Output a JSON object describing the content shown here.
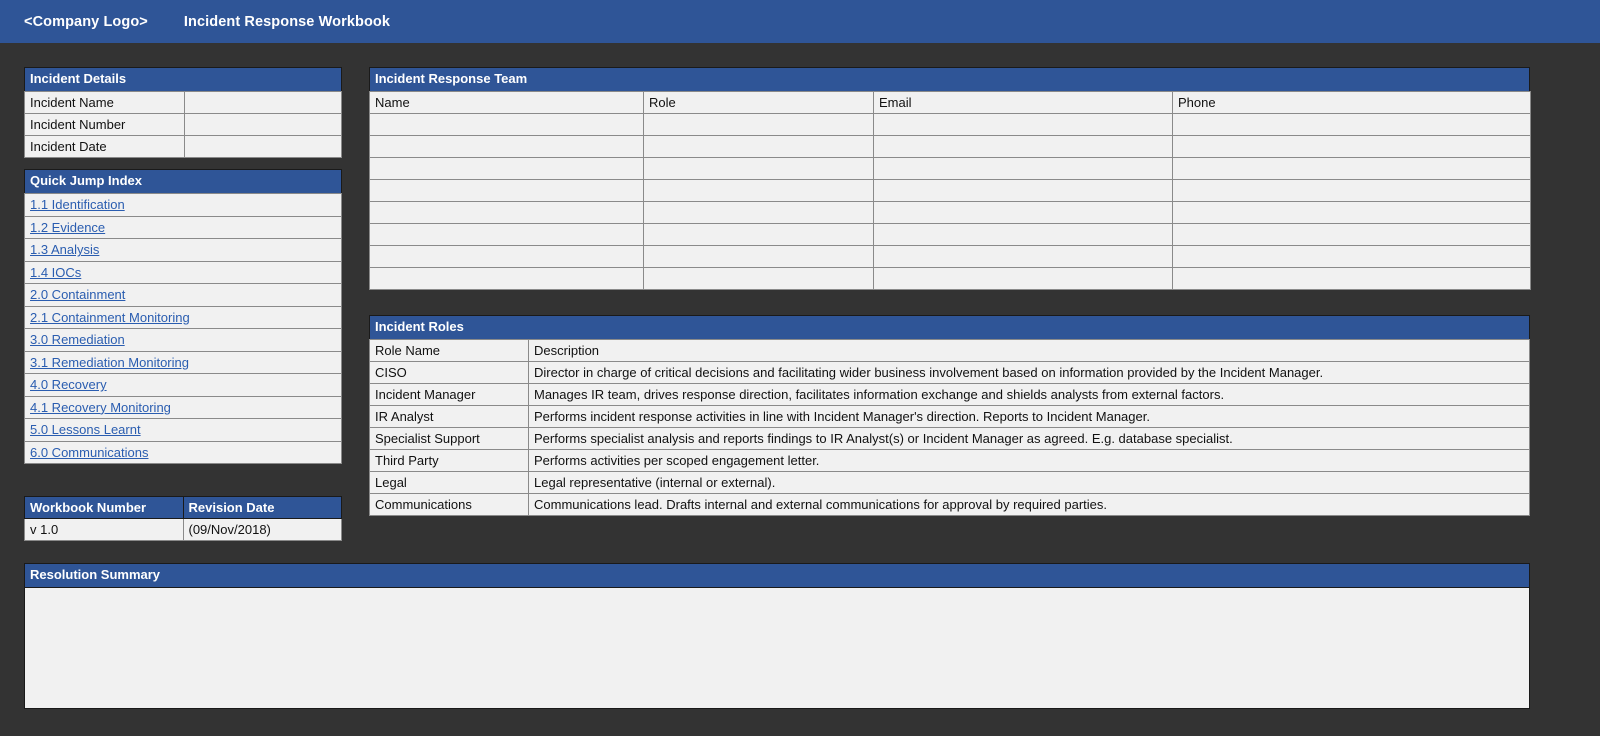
{
  "appbar": {
    "logo": "<Company Logo>",
    "title": "Incident Response Workbook"
  },
  "incident_details": {
    "header": "Incident Details",
    "rows": [
      {
        "label": "Incident Name",
        "value": ""
      },
      {
        "label": "Incident Number",
        "value": ""
      },
      {
        "label": "Incident Date",
        "value": ""
      }
    ]
  },
  "quick_jump": {
    "header": "Quick Jump Index",
    "links": [
      "1.1 Identification",
      "1.2 Evidence",
      "1.3 Analysis",
      "1.4 IOCs",
      "2.0 Containment",
      "2.1 Containment Monitoring",
      "3.0 Remediation",
      "3.1 Remediation Monitoring",
      "4.0 Recovery",
      "4.1 Recovery Monitoring",
      "5.0 Lessons Learnt",
      "6.0 Communications"
    ]
  },
  "workbook": {
    "col_number_header": "Workbook Number",
    "col_date_header": "Revision Date",
    "number": "v 1.0",
    "revision_date": "(09/Nov/2018)"
  },
  "ir_team": {
    "header": "Incident Response Team",
    "columns": [
      "Name",
      "Role",
      "Email",
      "Phone"
    ],
    "rows": [
      [
        "",
        "",
        "",
        ""
      ],
      [
        "",
        "",
        "",
        ""
      ],
      [
        "",
        "",
        "",
        ""
      ],
      [
        "",
        "",
        "",
        ""
      ],
      [
        "",
        "",
        "",
        ""
      ],
      [
        "",
        "",
        "",
        ""
      ],
      [
        "",
        "",
        "",
        ""
      ],
      [
        "",
        "",
        "",
        ""
      ]
    ]
  },
  "incident_roles": {
    "header": "Incident Roles",
    "columns": [
      "Role Name",
      "Description"
    ],
    "rows": [
      {
        "role": "CISO",
        "description": "Director in charge of critical decisions and facilitating wider business involvement based on information provided by the Incident Manager."
      },
      {
        "role": "Incident Manager",
        "description": "Manages IR team, drives response direction, facilitates information exchange and shields analysts from external factors."
      },
      {
        "role": "IR Analyst",
        "description": "Performs incident response activities in line with Incident Manager's direction. Reports to Incident Manager."
      },
      {
        "role": "Specialist Support",
        "description": "Performs specialist analysis and reports findings to IR Analyst(s) or Incident Manager as agreed. E.g. database specialist."
      },
      {
        "role": "Third Party",
        "description": "Performs activities per scoped engagement letter."
      },
      {
        "role": "Legal",
        "description": "Legal representative (internal or external)."
      },
      {
        "role": "Communications",
        "description": "Communications lead. Drafts internal and external communications for approval by required parties."
      }
    ]
  },
  "resolution": {
    "header": "Resolution Summary",
    "body": ""
  },
  "colors": {
    "header_blue": "#2F5597",
    "page_background": "#333333",
    "cell_fill": "#F1F1F1",
    "link_blue": "#2A5DB0"
  }
}
